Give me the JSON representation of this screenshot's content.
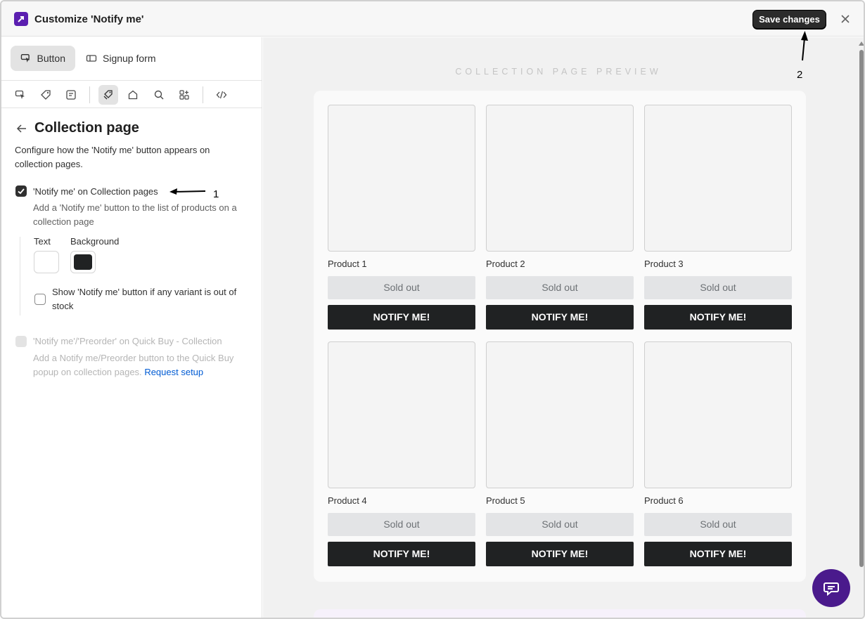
{
  "header": {
    "title": "Customize 'Notify me'",
    "save_label": "Save changes"
  },
  "tabs": [
    {
      "label": "Button",
      "active": true
    },
    {
      "label": "Signup form",
      "active": false
    }
  ],
  "icon_bar": [
    "cursor-icon",
    "tag-icon",
    "note-icon",
    "collection-icon",
    "home-icon",
    "search-icon",
    "apps-icon",
    "code-icon"
  ],
  "section": {
    "title": "Collection page",
    "description": "Configure how the 'Notify me' button appears on collection pages."
  },
  "option1": {
    "label": "'Notify me' on Collection pages",
    "help": "Add a 'Notify me' button to the list of products on a collection page",
    "checked": true
  },
  "colors": {
    "text_label": "Text",
    "background_label": "Background",
    "text_color": "#ffffff",
    "background_color": "#202223"
  },
  "option_variant": {
    "label": "Show 'Notify me' button if any variant is out of stock",
    "checked": false
  },
  "option2": {
    "label": "'Notify me'/'Preorder' on Quick Buy - Collection",
    "help": "Add a Notify me/Preorder button to the Quick Buy popup on collection pages.",
    "link": "Request setup",
    "disabled": true
  },
  "annotations": {
    "one": "1",
    "two": "2"
  },
  "preview": {
    "label": "COLLECTION PAGE PREVIEW",
    "products": [
      {
        "name": "Product 1",
        "status": "Sold out",
        "cta": "NOTIFY ME!"
      },
      {
        "name": "Product 2",
        "status": "Sold out",
        "cta": "NOTIFY ME!"
      },
      {
        "name": "Product 3",
        "status": "Sold out",
        "cta": "NOTIFY ME!"
      },
      {
        "name": "Product 4",
        "status": "Sold out",
        "cta": "NOTIFY ME!"
      },
      {
        "name": "Product 5",
        "status": "Sold out",
        "cta": "NOTIFY ME!"
      },
      {
        "name": "Product 6",
        "status": "Sold out",
        "cta": "NOTIFY ME!"
      }
    ]
  }
}
